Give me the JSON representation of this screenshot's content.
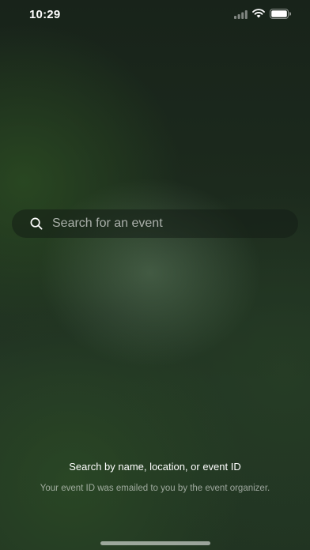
{
  "status_bar": {
    "time": "10:29",
    "icons": [
      "signal-icon",
      "wifi-icon",
      "battery-icon"
    ]
  },
  "search": {
    "icon": "search-icon",
    "placeholder": "Search for an event",
    "value": ""
  },
  "hint": {
    "title": "Search by name, location, or event ID",
    "subtitle": "Your event ID was emailed to you by the event organizer."
  },
  "colors": {
    "background_dark": "#18231a",
    "background_green": "#223524",
    "text_primary": "#ffffff"
  }
}
